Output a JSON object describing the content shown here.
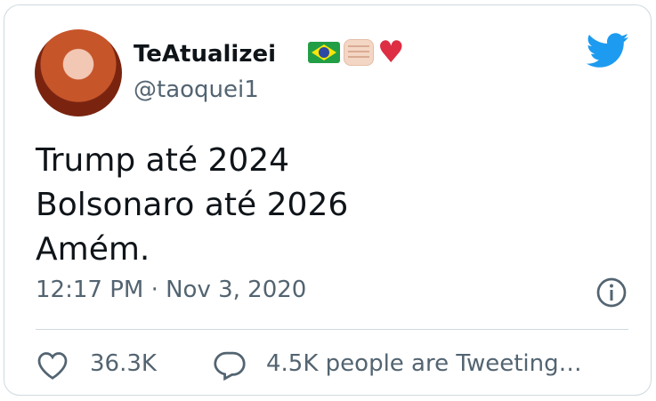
{
  "tweet": {
    "author_name": "TeAtualizei",
    "author_handle": "@taoquei1",
    "name_emojis": [
      "brazil-flag-icon",
      "fist-icon",
      "red-heart-icon"
    ],
    "lines": [
      "Trump até 2024",
      "Bolsonaro até 2026",
      "Amém."
    ],
    "timestamp": "12:17 PM · Nov 3, 2020"
  },
  "actions": {
    "like_count": "36.3K",
    "tweeting_label": "4.5K people are Tweeting…"
  },
  "colors": {
    "twitter_blue": "#1d9bf0",
    "secondary_text": "#536471",
    "primary_text": "#0f1419",
    "border": "#cfd9de"
  }
}
